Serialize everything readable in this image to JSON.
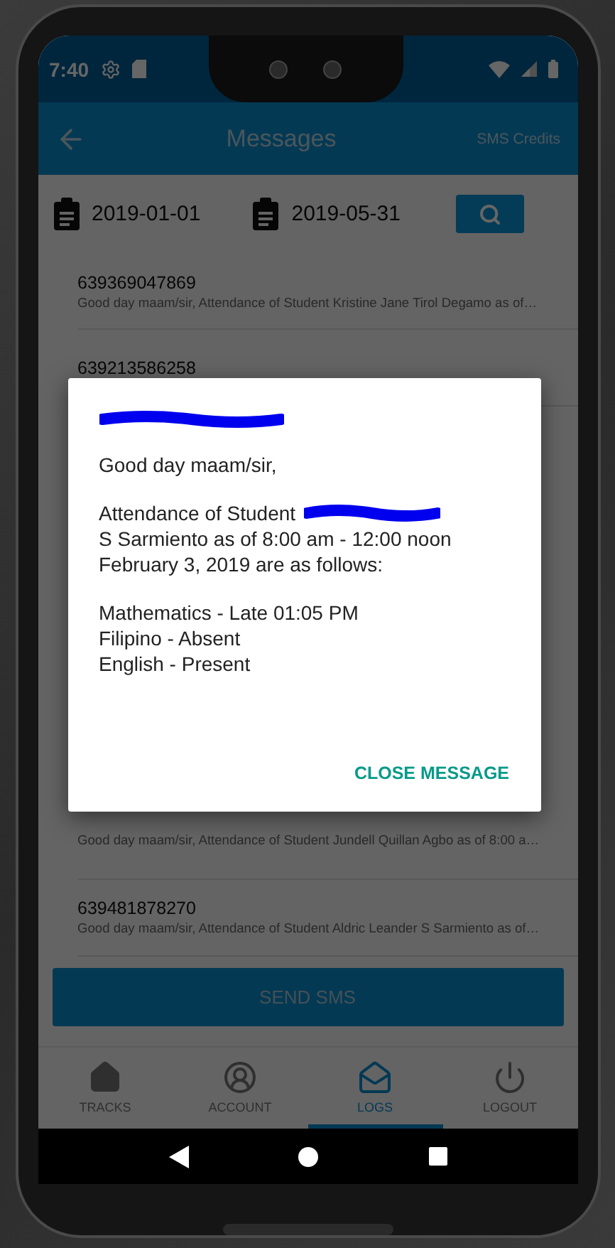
{
  "status_bar": {
    "time": "7:40"
  },
  "app_bar": {
    "title": "Messages",
    "action": "SMS Credits"
  },
  "filters": {
    "date_from": "2019-01-01",
    "date_to": "2019-05-31"
  },
  "messages_top": [
    {
      "number": "639369047869",
      "preview": "Good day maam/sir,  Attendance of Student  Kristine Jane Tirol Degamo as of…"
    },
    {
      "number": "639213586258"
    }
  ],
  "messages_bottom": [
    {
      "preview": "Good day maam/sir,  Attendance of Student  Jundell Quillan Agbo as of 8:00 a…"
    },
    {
      "number": "639481878270",
      "preview": "Good day maam/sir,  Attendance of Student  Aldric Leander S Sarmiento as of…"
    }
  ],
  "send_button": "SEND SMS",
  "bottom_nav": [
    {
      "kind": "home",
      "label": "TRACKS",
      "selected": false
    },
    {
      "kind": "account",
      "label": "ACCOUNT",
      "selected": false
    },
    {
      "kind": "logs",
      "label": "LOGS",
      "selected": true
    },
    {
      "kind": "logout",
      "label": "LOGOUT",
      "selected": false
    }
  ],
  "dialog": {
    "number_redacted": true,
    "greeting": "Good day maam/sir,",
    "student_redacted": true,
    "lines": [
      "Attendance of Student",
      "S Sarmiento as of 8:00 am - 12:00 noon",
      "February 3, 2019 are as follows:"
    ],
    "subjects": [
      "Mathematics - Late 01:05 PM",
      "Filipino - Absent",
      "English - Present"
    ],
    "close_button": "CLOSE MESSAGE"
  }
}
